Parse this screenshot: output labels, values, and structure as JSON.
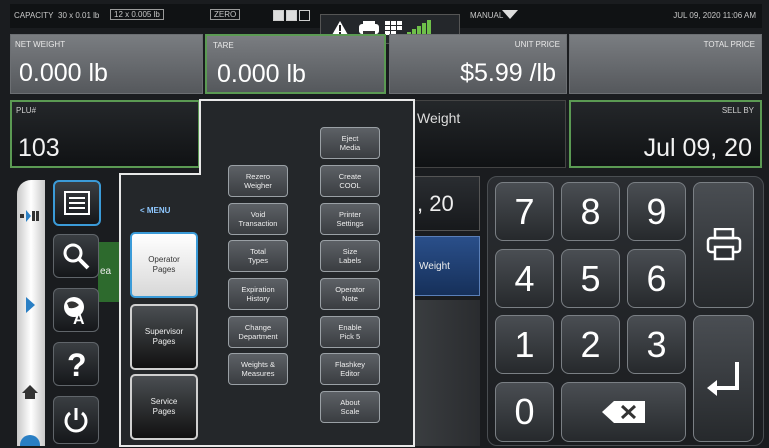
{
  "status_bar": {
    "capacity": "CAPACITY",
    "capacity_1": "30 x 0.01 lb",
    "capacity_2": "12 x 0.005 lb",
    "zero": "ZERO",
    "mode": "MANUAL",
    "datetime": "JUL 09, 2020 11:06 AM"
  },
  "header": {
    "net_weight_label": "NET WEIGHT",
    "net_weight_value": "0.000 lb",
    "tare_label": "TARE",
    "tare_value": "0.000 lb",
    "unit_price_label": "UNIT PRICE",
    "unit_price_value": "$5.99 /lb",
    "total_price_label": "TOTAL PRICE",
    "total_price_value": ""
  },
  "second_row": {
    "plu_label": "PLU#",
    "plu_value": "103",
    "weight_label": "Weight",
    "sell_by_label": "SELL BY",
    "sell_by_value": "Jul 09, 20",
    "date_partial": ", 20",
    "partial_ea": "ea",
    "weight_btn": "Weight"
  },
  "menu": {
    "title": "< MENU",
    "left_buttons": [
      "Operator\nPages",
      "Supervisor\nPages",
      "Service\nPages"
    ],
    "col1": [
      "Rezero\nWeigher",
      "Void\nTransaction",
      "Total\nTypes",
      "Expiration\nHistory",
      "Change\nDepartment",
      "Weights &\nMeasures"
    ],
    "col2": [
      "Eject\nMedia",
      "Create\nCOOL",
      "Printer\nSettings",
      "Size\nLabels",
      "Operator\nNote",
      "Enable\nPick 5",
      "Flashkey\nEditor",
      "About\nScale"
    ]
  },
  "keypad": {
    "keys": [
      "7",
      "8",
      "9",
      "4",
      "5",
      "6",
      "1",
      "2",
      "3",
      "0"
    ]
  },
  "icons": [
    "menu-list-icon",
    "search-icon",
    "language-icon",
    "help-icon",
    "power-icon",
    "printer-icon",
    "enter-icon",
    "backspace-icon",
    "warning-icon",
    "network-icon",
    "signal-icon",
    "home-icon",
    "arrow-right-icon",
    "scale-icon"
  ],
  "colors": {
    "accent_green": "#5b9a53",
    "highlight_blue": "#3b9bd8"
  }
}
